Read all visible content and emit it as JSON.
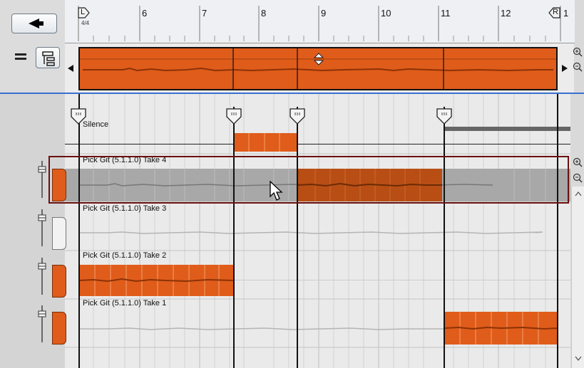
{
  "toolbar": {
    "back_icon": "left-triangle-icon",
    "list_view_icon": "list-lines-icon",
    "track_view_icon": "lane-tree-icon"
  },
  "ruler": {
    "bars": [
      "6",
      "7",
      "8",
      "9",
      "10",
      "11",
      "12",
      "1"
    ],
    "left_locator": "L",
    "right_locator": "R",
    "time_signature": "4/4"
  },
  "lanes": {
    "silence_label": "Silence",
    "takes": [
      {
        "label": "Pick Git (5.1.1.0) Take 4"
      },
      {
        "label": "Pick Git (5.1.1.0) Take 3"
      },
      {
        "label": "Pick Git (5.1.1.0) Take 2"
      },
      {
        "label": "Pick Git (5.1.1.0) Take 1"
      }
    ]
  },
  "colors": {
    "accent": "#e05c1a",
    "selection": "#6b1010",
    "separator": "#3a6fd0"
  }
}
